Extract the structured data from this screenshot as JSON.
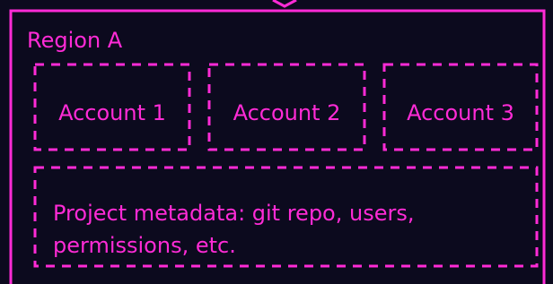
{
  "colors": {
    "background": "#0c0a1e",
    "accent": "#ff2bd6"
  },
  "diagram": {
    "region": {
      "title": "Region A",
      "accounts": [
        {
          "label": "Account 1"
        },
        {
          "label": "Account 2"
        },
        {
          "label": "Account 3"
        }
      ],
      "metadata_box": {
        "line1": "Project metadata: git repo, users,",
        "line2": "permissions, etc."
      }
    }
  }
}
